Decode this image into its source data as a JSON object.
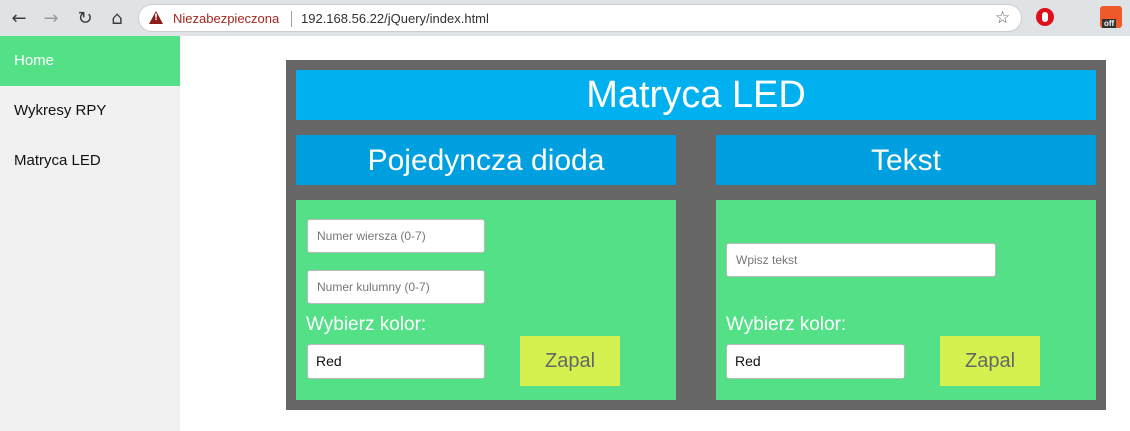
{
  "browser": {
    "security_label": "Niezabezpieczona",
    "url": "192.168.56.22/jQuery/index.html",
    "ext_badge": "off"
  },
  "sidebar": {
    "items": [
      {
        "label": "Home"
      },
      {
        "label": "Wykresy RPY"
      },
      {
        "label": "Matryca LED"
      }
    ]
  },
  "main": {
    "title": "Matryca LED",
    "single": {
      "header": "Pojedyncza dioda",
      "row_placeholder": "Numer wiersza (0-7)",
      "col_placeholder": "Numer kulumny (0-7)",
      "color_label": "Wybierz kolor:",
      "color_value": "Red",
      "button": "Zapal"
    },
    "text": {
      "header": "Tekst",
      "text_placeholder": "Wpisz tekst",
      "color_label": "Wybierz kolor:",
      "color_value": "Red",
      "button": "Zapal"
    }
  },
  "colors": {
    "accent_green": "#53e087",
    "title_blue": "#00b0ef",
    "header_blue": "#009fdf",
    "button_yellow": "#d4f150"
  }
}
